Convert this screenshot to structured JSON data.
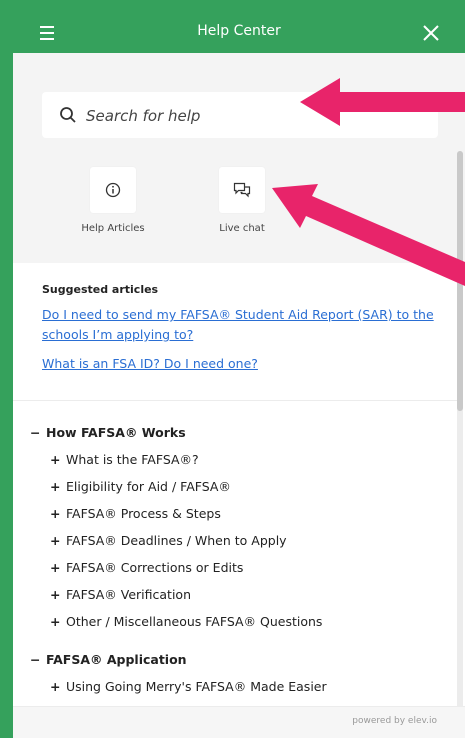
{
  "header": {
    "title": "Help Center"
  },
  "search": {
    "placeholder": "Search for help"
  },
  "quick_links": [
    {
      "label": "Help Articles",
      "icon": "info-icon"
    },
    {
      "label": "Live chat",
      "icon": "chat-icon"
    }
  ],
  "suggested": {
    "title": "Suggested articles",
    "articles": [
      "Do I need to send my FAFSA® Student Aid Report (SAR) to the schools I’m applying to?",
      "What is an FSA ID? Do I need one?"
    ]
  },
  "categories": [
    {
      "name": "How FAFSA® Works",
      "expanded": true,
      "items": [
        "What is the FAFSA®?",
        "Eligibility for Aid / FAFSA®",
        "FAFSA® Process & Steps",
        "FAFSA® Deadlines / When to Apply",
        "FAFSA® Corrections or Edits",
        "FAFSA® Verification",
        "Other / Miscellaneous FAFSA® Questions"
      ]
    },
    {
      "name": "FAFSA® Application",
      "expanded": true,
      "items": [
        "Using Going Merry's FAFSA® Made Easier"
      ]
    }
  ],
  "footer": {
    "powered_by": "powered by elev.io"
  },
  "colors": {
    "brand": "#35a15c",
    "link": "#2a6ed3",
    "annotation_arrow": "#e8246a"
  }
}
